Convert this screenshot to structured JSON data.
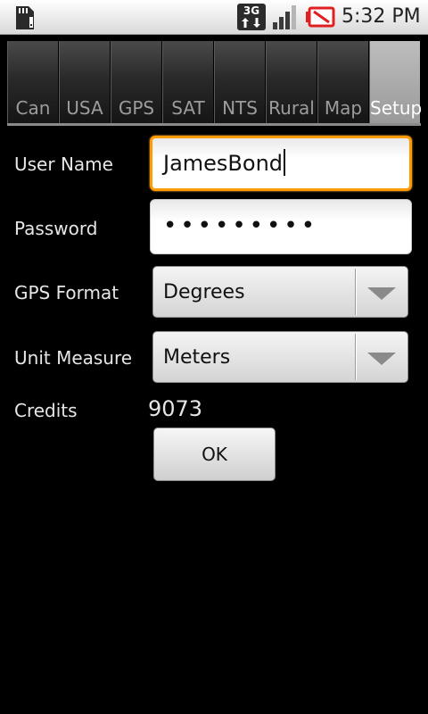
{
  "status_bar": {
    "network_label": "3G",
    "time": "5:32 PM",
    "icons": [
      "sd-card-icon",
      "network-3g-icon",
      "signal-icon",
      "battery-icon"
    ]
  },
  "tabs": [
    {
      "label": "Can",
      "active": false
    },
    {
      "label": "USA",
      "active": false
    },
    {
      "label": "GPS",
      "active": false
    },
    {
      "label": "SAT",
      "active": false
    },
    {
      "label": "NTS",
      "active": false
    },
    {
      "label": "Rural",
      "active": false
    },
    {
      "label": "Map",
      "active": false
    },
    {
      "label": "Setup",
      "active": true
    }
  ],
  "form": {
    "username_label": "User Name",
    "username_value": "JamesBond",
    "password_label": "Password",
    "password_mask": "•••••••••",
    "gps_format_label": "GPS Format",
    "gps_format_value": "Degrees",
    "unit_measure_label": "Unit Measure",
    "unit_measure_value": "Meters",
    "credits_label": "Credits",
    "credits_value": "9073",
    "ok_label": "OK"
  },
  "colors": {
    "focus_border": "#ff9a00",
    "background": "#000000",
    "active_tab": "#9a9a9a"
  }
}
